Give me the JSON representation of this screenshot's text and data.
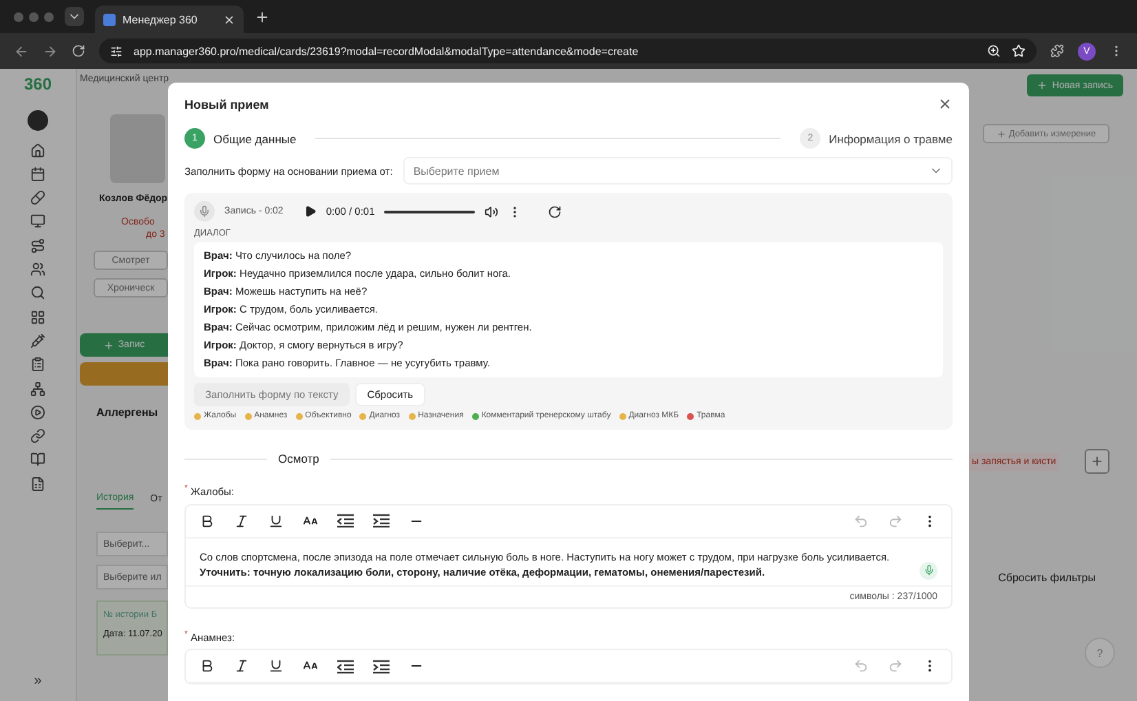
{
  "browser": {
    "tab_title": "Менеджер 360",
    "url": "app.manager360.pro/medical/cards/23619?modal=recordModal&modalType=attendance&mode=create",
    "profile_initial": "V"
  },
  "app": {
    "logo": "360",
    "expand": "»"
  },
  "background": {
    "breadcrumb": "Медицинский центр",
    "patient_name": "Козлов Фёдор",
    "status": "Освобо",
    "status_until": "до 3",
    "buttons": [
      "Смотрет",
      "Хроническ"
    ],
    "record_button": "Запис",
    "allergens_title": "Аллергены",
    "tabs": [
      {
        "label": "История",
        "selected": true
      },
      {
        "label": "От",
        "selected": false
      }
    ],
    "selects": [
      "Выберит...",
      "Выберите ил"
    ],
    "history_card": {
      "number": "№ истории Б",
      "date": "Дата: 11.07.20"
    },
    "new_record_button": "Новая запись",
    "add_measurement_button": "Добавить измерение",
    "injury_tag": "ы запястья и кисти",
    "reset_filters": "Сбросить фильтры",
    "help": "?"
  },
  "modal": {
    "title": "Новый прием",
    "steps": [
      {
        "number": "1",
        "label": "Общие данные",
        "selected": true
      },
      {
        "number": "2",
        "label": "Информация о травме",
        "selected": false
      }
    ],
    "prefill": {
      "label": "Заполнить форму на основании приема от:",
      "placeholder": "Выберите прием"
    },
    "recording": {
      "label": "Запись - 0:02",
      "time": "0:00 / 0:01"
    },
    "dialog": {
      "heading": "ДИАЛОГ",
      "lines": [
        {
          "speaker": "Врач:",
          "text": "Что случилось на поле?"
        },
        {
          "speaker": "Игрок:",
          "text": "Неудачно приземлился после удара, сильно болит нога."
        },
        {
          "speaker": "Врач:",
          "text": "Можешь наступить на неё?"
        },
        {
          "speaker": "Игрок:",
          "text": "С трудом, боль усиливается."
        },
        {
          "speaker": "Врач:",
          "text": "Сейчас осмотрим, приложим лёд и решим, нужен ли рентген."
        },
        {
          "speaker": "Игрок:",
          "text": "Доктор, я смогу вернуться в игру?"
        },
        {
          "speaker": "Врач:",
          "text": "Пока рано говорить. Главное — не усугубить травму."
        }
      ]
    },
    "actions": [
      {
        "label": "Заполнить форму по тексту",
        "disabled": true
      },
      {
        "label": "Сбросить",
        "disabled": false
      }
    ],
    "legend": [
      {
        "label": "Жалобы",
        "color": "#e6b54a"
      },
      {
        "label": "Анамнез",
        "color": "#e6b54a"
      },
      {
        "label": "Объективно",
        "color": "#e6b54a"
      },
      {
        "label": "Диагноз",
        "color": "#e6b54a"
      },
      {
        "label": "Назначения",
        "color": "#e6b54a"
      },
      {
        "label": "Комментарий тренерскому штабу",
        "color": "#4caf50"
      },
      {
        "label": "Диагноз МКБ",
        "color": "#e6b54a"
      },
      {
        "label": "Травма",
        "color": "#d9534f"
      }
    ],
    "section": "Осмотр",
    "fields": [
      {
        "mark": "*",
        "label": "Жалобы:",
        "text": "Со слов спортсмена, после эпизода на поле отмечает сильную боль в ноге. Наступить на ногу может с трудом, при нагрузке боль усиливается.",
        "note": "Уточнить: точную локализацию боли, сторону, наличие отёка, деформации, гематомы, онемения/парестезий.",
        "counter": "символы : 237/1000"
      },
      {
        "mark": "*",
        "label": "Анамнез:"
      }
    ]
  }
}
